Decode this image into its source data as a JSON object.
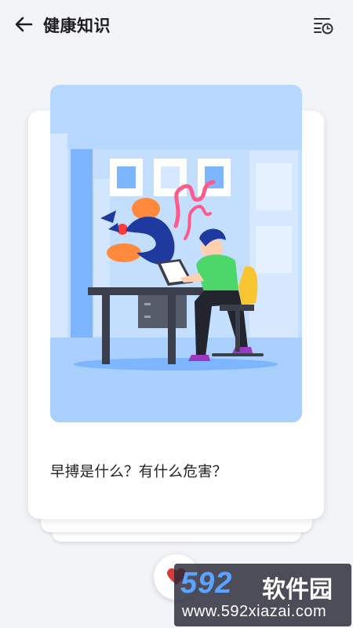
{
  "header": {
    "title": "健康知识",
    "back_icon": "arrow-left-icon",
    "history_icon": "list-clock-icon"
  },
  "card": {
    "illustration": "person-working-at-desk-illustration",
    "question": "早搏是什么？有什么危害？"
  },
  "favorite": {
    "icon": "heart-icon",
    "color": "#d63a3a"
  },
  "watermark": {
    "logo": "592",
    "name": "软件园",
    "url": "www.592xiazai.com"
  },
  "colors": {
    "background": "#f3f4f8",
    "illustration_bg": "#b6d7ff",
    "accent_green": "#4dd66a",
    "accent_yellow": "#f7c531"
  }
}
